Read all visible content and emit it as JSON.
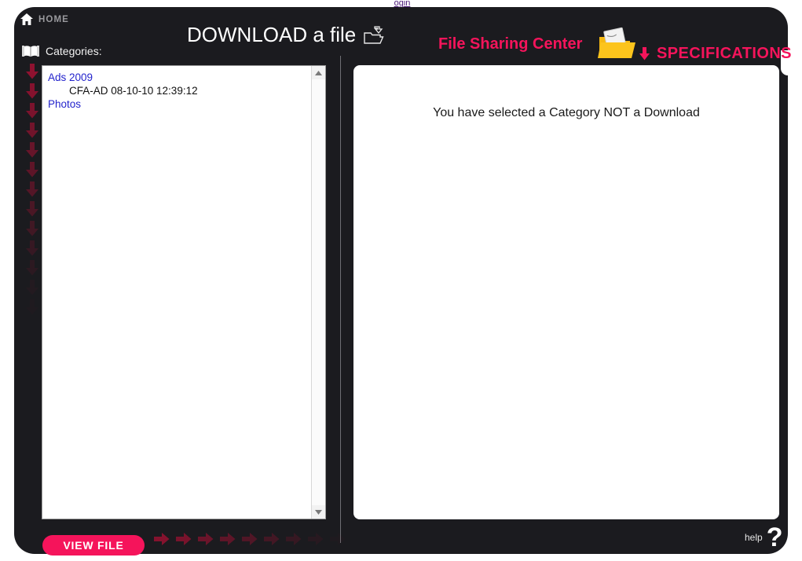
{
  "top_stub": {
    "text": "ogin"
  },
  "header": {
    "home_label": "HOME",
    "home_icon": "house-icon",
    "title": "DOWNLOAD a file",
    "title_icon": "folder-upload-icon",
    "file_sharing_label": "File Sharing Center",
    "file_sharing_icon": "yellow-folder-document-icon",
    "specifications_label": "SPECIFICATIONS",
    "specifications_icon": "arrow-down-icon",
    "categories_label": "Categories:",
    "categories_icon": "open-book-icon"
  },
  "list": {
    "rows": [
      {
        "type": "category",
        "label": "Ads 2009"
      },
      {
        "type": "file",
        "label": "CFA-AD  08-10-10 12:39:12"
      },
      {
        "type": "category",
        "label": "Photos"
      }
    ],
    "scrollbar": {
      "up_icon": "scroll-up-arrow-icon",
      "down_icon": "scroll-down-arrow-icon"
    }
  },
  "content": {
    "message": "You have selected a Category NOT a Download"
  },
  "footer": {
    "view_file_label": "VIEW FILE",
    "help_label": "help",
    "help_icon": "question-mark-icon"
  },
  "decor": {
    "down_arrow_count": 13,
    "right_arrow_count": 9
  },
  "colors": {
    "accent_pink": "#f5145b",
    "panel_dark": "#1b1b1f",
    "link_blue": "#2222cc",
    "link_purple": "#4b1a78"
  }
}
